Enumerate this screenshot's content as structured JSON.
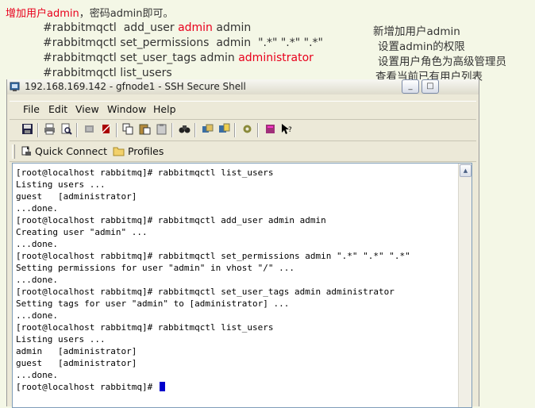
{
  "note": {
    "intro_prefix": "增加用户",
    "intro_user": "admin",
    "intro_suffix": "，密码admin即可。",
    "cmd1": "#rabbitmqctl  add_user ",
    "cmd1_user": "admin",
    "cmd1_pass": " admin",
    "cmd2": "#rabbitmqctl set_permissions  admin  \".*\" \".*\" \".*\"",
    "cmd3": "#rabbitmqctl set_user_tags admin ",
    "cmd3_tag": "administrator",
    "cmd4": "#rabbitmqctl list_users",
    "desc1": "新增加用户admin",
    "desc2": "设置admin的权限",
    "desc3": "设置用户角色为高级管理员",
    "desc4": "查看当前已有用户列表",
    "highlight_color": "#e8001c"
  },
  "window": {
    "title": "192.168.169.142 - gfnode1 - SSH Secure Shell",
    "minimize": "_",
    "maximize": "□",
    "menu": [
      "File",
      "Edit",
      "View",
      "Window",
      "Help"
    ],
    "toolbar_icons": [
      "save-icon",
      "print-icon",
      "print-preview-icon",
      "profile-icon",
      "disconnect-icon",
      "copy-icon",
      "paste-icon",
      "clipboard-icon",
      "find-icon",
      "settings-icon",
      "file-transfer-icon",
      "gear-icon",
      "help-book-icon",
      "context-help-icon"
    ],
    "quick_connect": "Quick Connect",
    "profiles": "Profiles"
  },
  "terminal": {
    "lines": [
      "[root@localhost rabbitmq]# rabbitmqctl list_users",
      "Listing users ...",
      "guest   [administrator]",
      "...done.",
      "[root@localhost rabbitmq]# rabbitmqctl add_user admin admin",
      "Creating user \"admin\" ...",
      "...done.",
      "[root@localhost rabbitmq]# rabbitmqctl set_permissions admin \".*\" \".*\" \".*\"",
      "Setting permissions for user \"admin\" in vhost \"/\" ...",
      "...done.",
      "[root@localhost rabbitmq]# rabbitmqctl set_user_tags admin administrator",
      "Setting tags for user \"admin\" to [administrator] ...",
      "...done.",
      "[root@localhost rabbitmq]# rabbitmqctl list_users",
      "Listing users ...",
      "admin   [administrator]",
      "guest   [administrator]",
      "...done.",
      "[root@localhost rabbitmq]# "
    ],
    "cursor_color": "#0000cc"
  }
}
